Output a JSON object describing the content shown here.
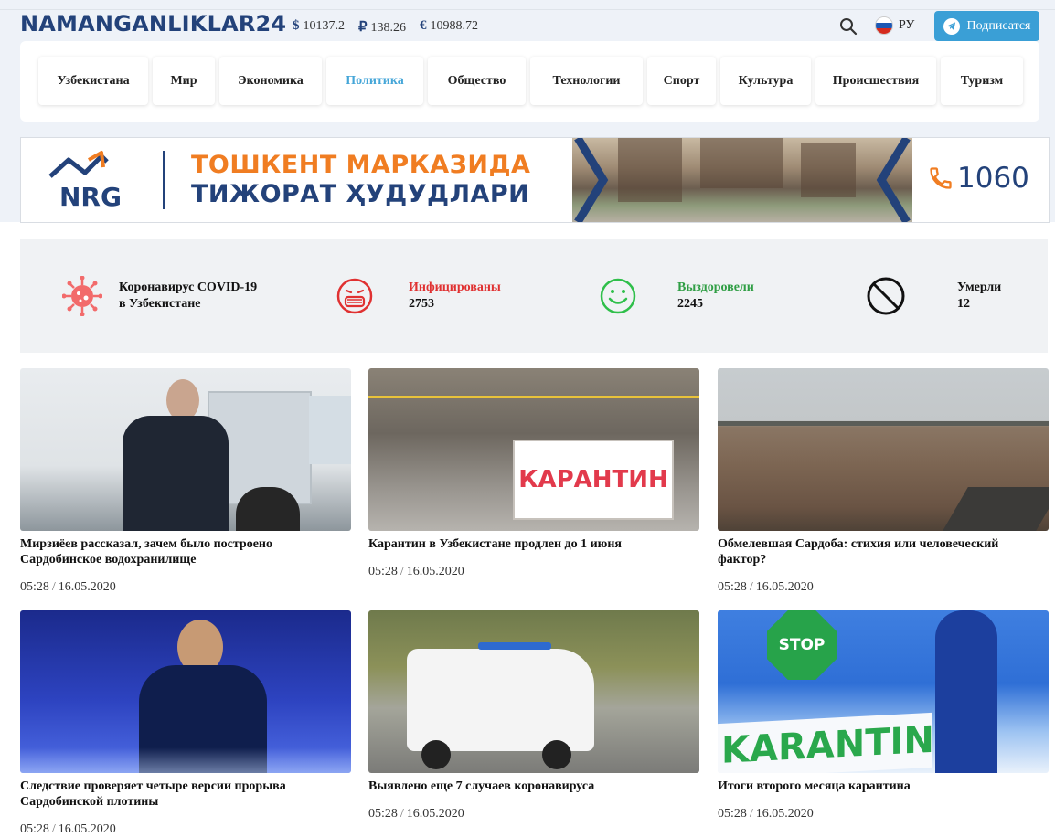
{
  "header": {
    "logo": "NAMANGANLIKLAR24",
    "rates": [
      {
        "symbol": "$",
        "value": "10137.2"
      },
      {
        "symbol": "₽",
        "value": "138.26"
      },
      {
        "symbol": "€",
        "value": "10988.72"
      }
    ],
    "language": "РУ",
    "subscribe_label": "Подписатся"
  },
  "nav": {
    "items": [
      {
        "label": "Узбекистана",
        "active": false
      },
      {
        "label": "Мир",
        "active": false
      },
      {
        "label": "Экономика",
        "active": false
      },
      {
        "label": "Политика",
        "active": true
      },
      {
        "label": "Общество",
        "active": false
      },
      {
        "label": "Технологии",
        "active": false
      },
      {
        "label": "Спорт",
        "active": false
      },
      {
        "label": "Культура",
        "active": false
      },
      {
        "label": "Происшествия",
        "active": false
      },
      {
        "label": "Туризм",
        "active": false
      }
    ]
  },
  "banner": {
    "brand": "NRG",
    "line1": "ТОШКЕНТ МАРКАЗИДА",
    "line2": "ТИЖОРАТ ҲУДУДЛАРИ",
    "phone": "1060"
  },
  "covid": {
    "title_line1": "Коронавирус COVID-19",
    "title_line2": "в Узбекистане",
    "infected_label": "Инфицированы",
    "infected_value": "2753",
    "recovered_label": "Выздоровели",
    "recovered_value": "2245",
    "died_label": "Умерли",
    "died_value": "12",
    "colors": {
      "infected": "#e03131",
      "recovered": "#2f9e44",
      "died": "#111111"
    }
  },
  "news": [
    {
      "title": "Мирзиёев рассказал, зачем было построено Сардобинское водохранилище",
      "time": "05:28",
      "date": "16.05.2020"
    },
    {
      "title": "Карантин в Узбекистане продлен до 1 июня",
      "time": "05:28",
      "date": "16.05.2020",
      "image_text": "КАРАНТИН"
    },
    {
      "title": "Обмелевшая Сардоба: стихия или человеческий фактор?",
      "time": "05:28",
      "date": "16.05.2020"
    },
    {
      "title": "Следствие проверяет четыре версии прорыва Сардобинской плотины",
      "time": "05:28",
      "date": "16.05.2020"
    },
    {
      "title": "Выявлено еще 7 случаев коронавируса",
      "time": "05:28",
      "date": "16.05.2020"
    },
    {
      "title": "Итоги второго месяца карантина",
      "time": "05:28",
      "date": "16.05.2020",
      "image_text": "KARANTIN",
      "image_sign": "STOP"
    }
  ]
}
